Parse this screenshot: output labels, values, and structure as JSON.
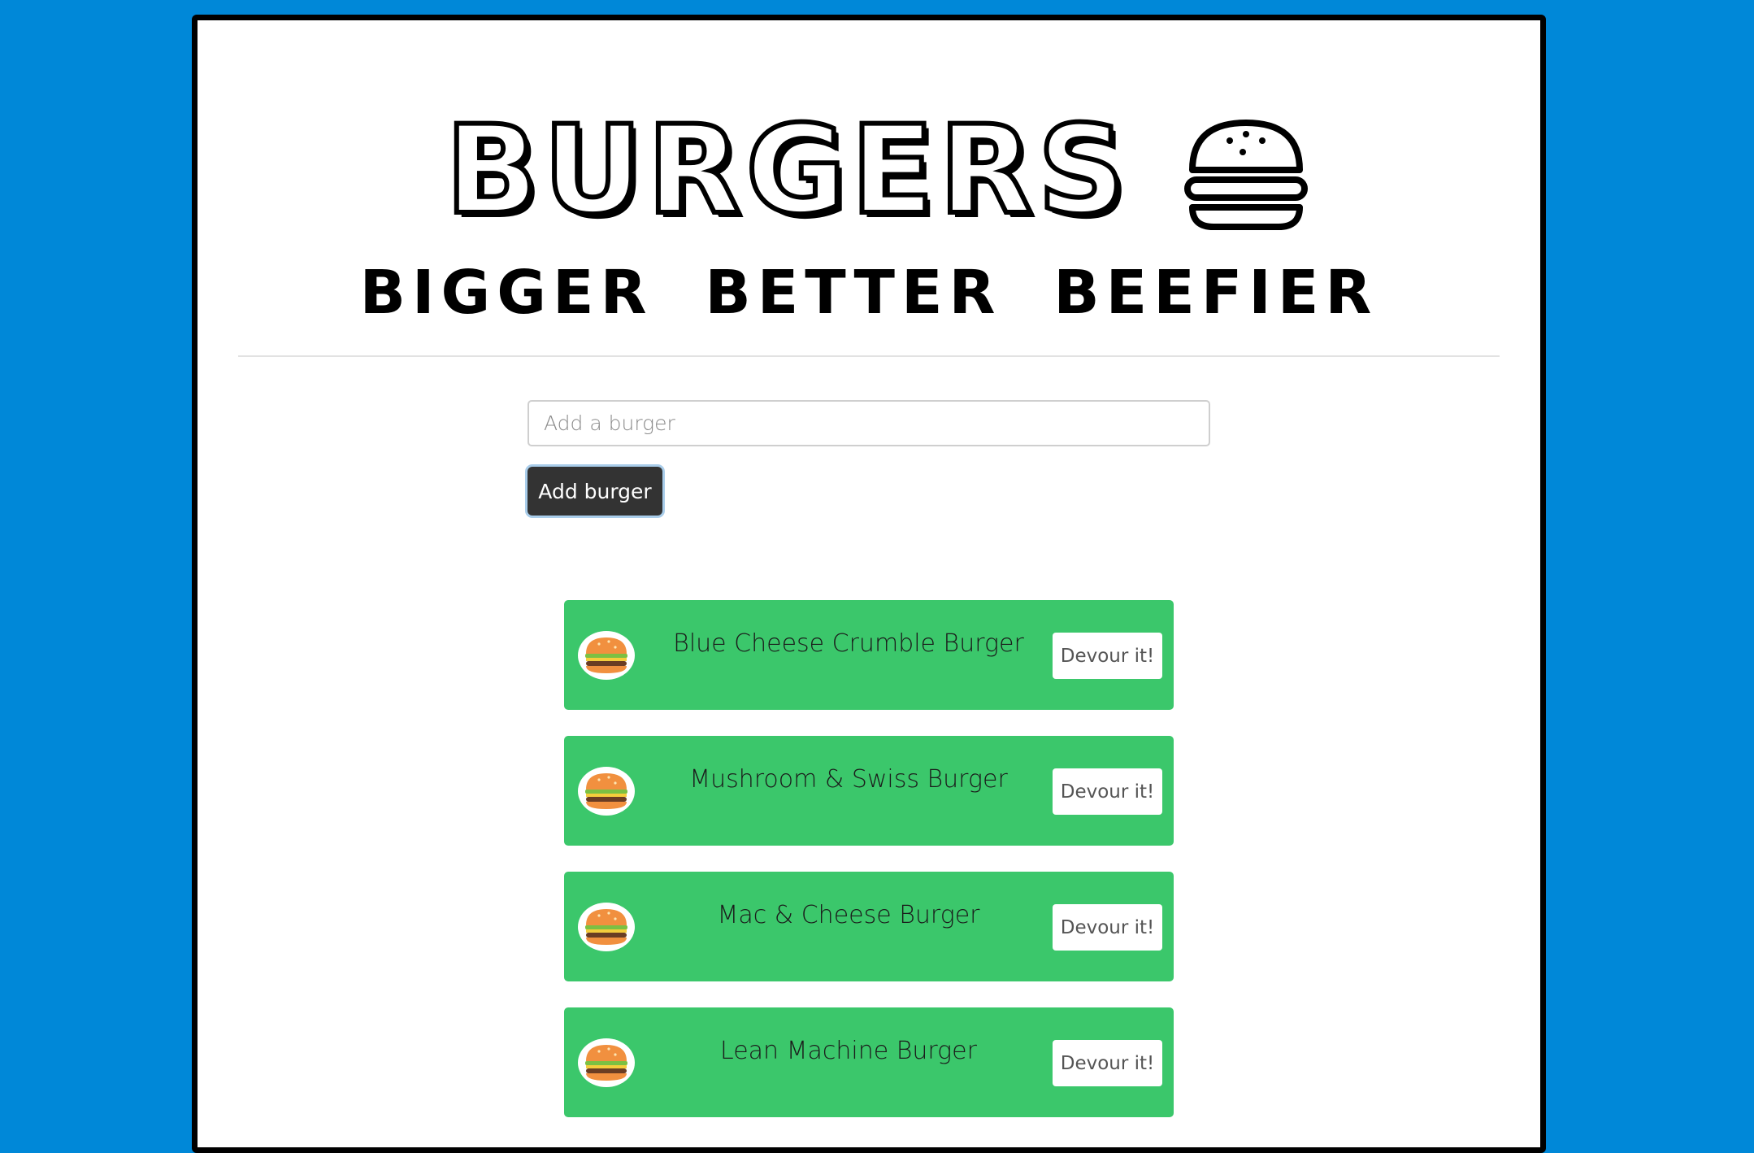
{
  "header": {
    "brand": "BURGERS",
    "brand_icon": "burger-icon",
    "tagline": "BIGGER BETTER BEEFIER"
  },
  "form": {
    "placeholder": "Add a burger",
    "value": "",
    "submit_label": "Add burger"
  },
  "burgers": [
    {
      "name": "Blue Cheese Crumble Burger",
      "action": "Devour it!",
      "icon": "burger-thumbnail-icon"
    },
    {
      "name": "Mushroom & Swiss Burger",
      "action": "Devour it!",
      "icon": "burger-thumbnail-icon"
    },
    {
      "name": "Mac & Cheese Burger",
      "action": "Devour it!",
      "icon": "burger-thumbnail-icon"
    },
    {
      "name": "Lean Machine Burger",
      "action": "Devour it!",
      "icon": "burger-thumbnail-icon"
    }
  ],
  "colors": {
    "background": "#0088d8",
    "card": "#ffffff",
    "row": "#3bc76b",
    "button": "#333333"
  }
}
